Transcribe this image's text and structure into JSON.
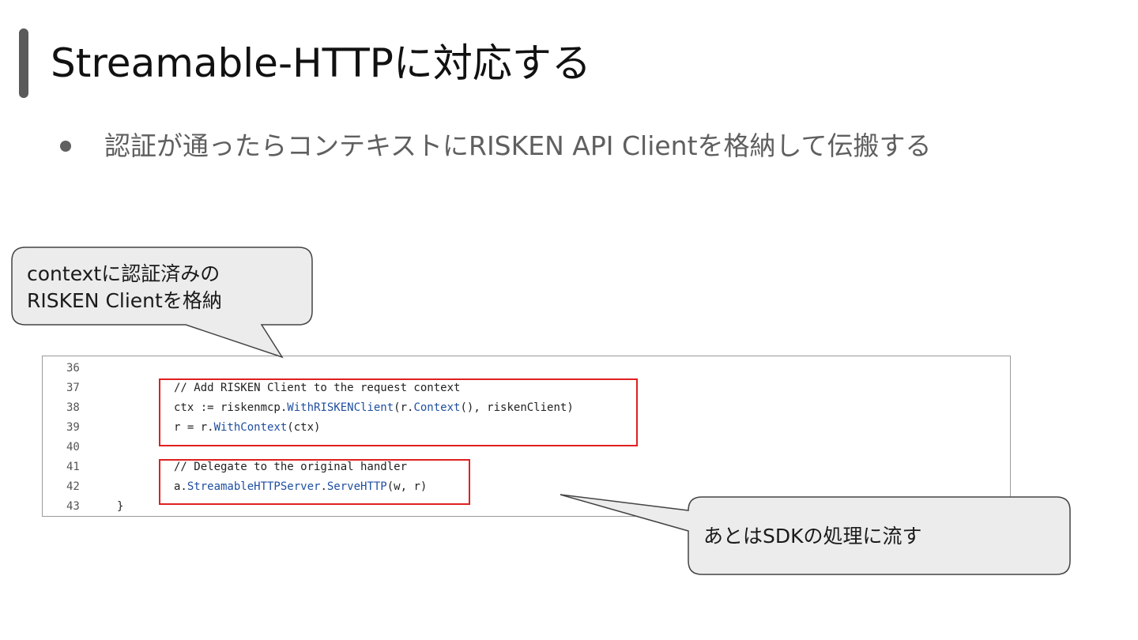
{
  "slide": {
    "title": "Streamable-HTTPに対応する",
    "bullet": "認証が通ったらコンテキストにRISKEN API Clientを格納して伝搬する"
  },
  "callouts": [
    {
      "lines": [
        "contextに認証済みの",
        "RISKEN Clientを格納"
      ]
    },
    {
      "lines": [
        "あとはSDKの処理に流す"
      ]
    }
  ],
  "code": {
    "lines": [
      {
        "num": "36",
        "parts": []
      },
      {
        "num": "37",
        "parts": [
          {
            "t": "// Add RISKEN Client to the request context",
            "k": "plain"
          }
        ]
      },
      {
        "num": "38",
        "parts": [
          {
            "t": "ctx := riskenmcp.",
            "k": "plain"
          },
          {
            "t": "WithRISKENClient",
            "k": "fn"
          },
          {
            "t": "(r.",
            "k": "plain"
          },
          {
            "t": "Context",
            "k": "fn"
          },
          {
            "t": "(), riskenClient)",
            "k": "plain"
          }
        ]
      },
      {
        "num": "39",
        "parts": [
          {
            "t": "r = r.",
            "k": "plain"
          },
          {
            "t": "WithContext",
            "k": "fn"
          },
          {
            "t": "(ctx)",
            "k": "plain"
          }
        ]
      },
      {
        "num": "40",
        "parts": []
      },
      {
        "num": "41",
        "parts": [
          {
            "t": "// Delegate to the original handler",
            "k": "plain"
          }
        ]
      },
      {
        "num": "42",
        "parts": [
          {
            "t": "a.",
            "k": "plain"
          },
          {
            "t": "StreamableHTTPServer",
            "k": "fn"
          },
          {
            "t": ".",
            "k": "plain"
          },
          {
            "t": "ServeHTTP",
            "k": "fn"
          },
          {
            "t": "(w, r)",
            "k": "plain"
          }
        ]
      },
      {
        "num": "43",
        "parts": [
          {
            "t": "}",
            "k": "plain"
          }
        ]
      }
    ]
  },
  "colors": {
    "title_bar": "#5a5a5a",
    "highlight_border": "#e02020",
    "function_name": "#1f4fa0",
    "callout_fill": "#ececec"
  }
}
